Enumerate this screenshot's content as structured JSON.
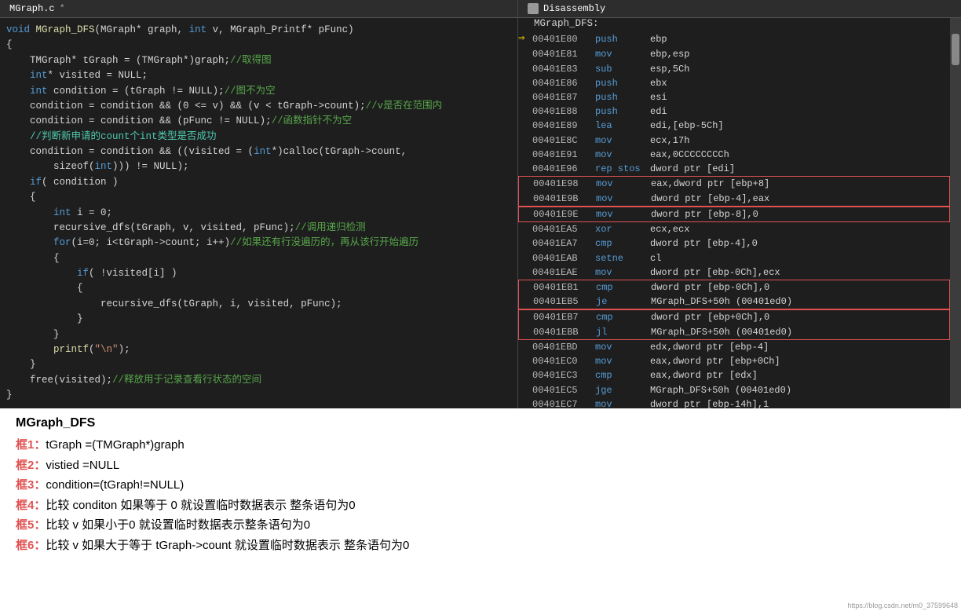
{
  "editor": {
    "tab_label": "MGraph.c",
    "tab_modified": "*",
    "lines": [
      {
        "indent": 0,
        "parts": [
          {
            "t": "kw",
            "v": "void "
          },
          {
            "t": "fn",
            "v": "MGraph_DFS"
          },
          {
            "t": "normal",
            "v": "(MGraph* graph, "
          },
          {
            "t": "kw",
            "v": "int"
          },
          {
            "t": "normal",
            "v": " v, MGraph_Printf* pFunc)"
          }
        ]
      },
      {
        "indent": 0,
        "parts": [
          {
            "t": "normal",
            "v": "{"
          }
        ]
      },
      {
        "indent": 1,
        "parts": [
          {
            "t": "normal",
            "v": "TMGraph* tGraph = (TMGraph*)graph;"
          },
          {
            "t": "cm",
            "v": "//取得图"
          }
        ]
      },
      {
        "indent": 1,
        "parts": [
          {
            "t": "kw",
            "v": "int"
          },
          {
            "t": "normal",
            "v": "* visited = NULL;"
          }
        ]
      },
      {
        "indent": 1,
        "parts": [
          {
            "t": "kw",
            "v": "int"
          },
          {
            "t": "normal",
            "v": " condition = (tGraph != NULL);"
          },
          {
            "t": "cm",
            "v": "//图不为空"
          }
        ]
      },
      {
        "indent": 0,
        "parts": []
      },
      {
        "indent": 1,
        "parts": [
          {
            "t": "normal",
            "v": "condition = condition && (0 <= v) && (v < tGraph->count);"
          },
          {
            "t": "cm",
            "v": "//v是否在范围内"
          }
        ]
      },
      {
        "indent": 1,
        "parts": [
          {
            "t": "normal",
            "v": "condition = condition && (pFunc != NULL);"
          },
          {
            "t": "cm",
            "v": "//函数指针不为空"
          }
        ]
      },
      {
        "indent": 1,
        "parts": [
          {
            "t": "cm-blue",
            "v": "//判断新申请的count个int类型是否成功"
          }
        ]
      },
      {
        "indent": 1,
        "parts": [
          {
            "t": "normal",
            "v": "condition = condition && ((visited = ("
          },
          {
            "t": "kw",
            "v": "int"
          },
          {
            "t": "normal",
            "v": "*)calloc(tGraph->count,"
          }
        ]
      },
      {
        "indent": 2,
        "parts": [
          {
            "t": "normal",
            "v": "sizeof("
          },
          {
            "t": "kw",
            "v": "int"
          },
          {
            "t": "normal",
            "v": "))) != NULL);"
          }
        ]
      },
      {
        "indent": 1,
        "parts": [
          {
            "t": "kw",
            "v": "if"
          },
          {
            "t": "normal",
            "v": "( condition )"
          }
        ]
      },
      {
        "indent": 1,
        "parts": [
          {
            "t": "normal",
            "v": "{"
          }
        ]
      },
      {
        "indent": 2,
        "parts": [
          {
            "t": "kw",
            "v": "int"
          },
          {
            "t": "normal",
            "v": " i = 0;"
          }
        ]
      },
      {
        "indent": 2,
        "parts": [
          {
            "t": "normal",
            "v": "recursive_dfs(tGraph, v, visited, pFunc);"
          },
          {
            "t": "cm",
            "v": "//调用递归检测"
          }
        ]
      },
      {
        "indent": 0,
        "parts": []
      },
      {
        "indent": 2,
        "parts": [
          {
            "t": "kw",
            "v": "for"
          },
          {
            "t": "normal",
            "v": "(i=0; i<tGraph->count; i++)"
          },
          {
            "t": "cm",
            "v": "//如果还有行没遍历的，再从该行开始遍历"
          }
        ]
      },
      {
        "indent": 2,
        "parts": [
          {
            "t": "normal",
            "v": "{"
          }
        ]
      },
      {
        "indent": 3,
        "parts": [
          {
            "t": "kw",
            "v": "if"
          },
          {
            "t": "normal",
            "v": "( !visited[i] )"
          }
        ]
      },
      {
        "indent": 3,
        "parts": [
          {
            "t": "normal",
            "v": "{"
          }
        ]
      },
      {
        "indent": 0,
        "parts": []
      },
      {
        "indent": 4,
        "parts": [
          {
            "t": "normal",
            "v": "recursive_dfs(tGraph, i, visited, pFunc);"
          }
        ]
      },
      {
        "indent": 3,
        "parts": [
          {
            "t": "normal",
            "v": "}"
          }
        ]
      },
      {
        "indent": 2,
        "parts": [
          {
            "t": "normal",
            "v": "}"
          }
        ]
      },
      {
        "indent": 2,
        "parts": [
          {
            "t": "fn",
            "v": "printf"
          },
          {
            "t": "normal",
            "v": "("
          },
          {
            "t": "str",
            "v": "\"\\n\""
          },
          {
            "t": "normal",
            "v": ");"
          }
        ]
      },
      {
        "indent": 1,
        "parts": [
          {
            "t": "normal",
            "v": "}"
          }
        ]
      },
      {
        "indent": 1,
        "parts": [
          {
            "t": "normal",
            "v": "free(visited);"
          },
          {
            "t": "cm",
            "v": "//释放用于记录查看行状态的空间"
          }
        ]
      },
      {
        "indent": 0,
        "parts": [
          {
            "t": "normal",
            "v": "}"
          }
        ]
      },
      {
        "indent": 0,
        "parts": [
          {
            "t": "normal",
            "v": "..."
          }
        ]
      }
    ]
  },
  "disassembly": {
    "tab_label": "Disassembly",
    "function_name": "MGraph_DFS:",
    "rows": [
      {
        "addr": "00401E80",
        "op": "push",
        "operand": "ebp",
        "arrow": true,
        "box_start": false,
        "box_end": false
      },
      {
        "addr": "00401E81",
        "op": "mov",
        "operand": "ebp,esp",
        "arrow": false,
        "box_start": false,
        "box_end": false
      },
      {
        "addr": "00401E83",
        "op": "sub",
        "operand": "esp,5Ch",
        "arrow": false,
        "box_start": false,
        "box_end": false
      },
      {
        "addr": "00401E86",
        "op": "push",
        "operand": "ebx",
        "arrow": false,
        "box_start": false,
        "box_end": false
      },
      {
        "addr": "00401E87",
        "op": "push",
        "operand": "esi",
        "arrow": false,
        "box_start": false,
        "box_end": false
      },
      {
        "addr": "00401E88",
        "op": "push",
        "operand": "edi",
        "arrow": false,
        "box_start": false,
        "box_end": false
      },
      {
        "addr": "00401E89",
        "op": "lea",
        "operand": "edi,[ebp-5Ch]",
        "arrow": false,
        "box_start": false,
        "box_end": false
      },
      {
        "addr": "00401E8C",
        "op": "mov",
        "operand": "ecx,17h",
        "arrow": false,
        "box_start": false,
        "box_end": false
      },
      {
        "addr": "00401E91",
        "op": "mov",
        "operand": "eax,0CCCCCCCCh",
        "arrow": false,
        "box_start": false,
        "box_end": false
      },
      {
        "addr": "00401E96",
        "op": "rep stos",
        "operand": "dword ptr [edi]",
        "arrow": false,
        "box_start": false,
        "box_end": false
      },
      {
        "addr": "00401E98",
        "op": "mov",
        "operand": "eax,dword ptr [ebp+8]",
        "arrow": false,
        "box_start": true,
        "box_end": false,
        "box_group": 1
      },
      {
        "addr": "00401E9B",
        "op": "mov",
        "operand": "dword ptr [ebp-4],eax",
        "arrow": false,
        "box_start": false,
        "box_end": true,
        "box_group": 1
      },
      {
        "addr": "00401E9E",
        "op": "mov",
        "operand": "dword ptr [ebp-8],0",
        "arrow": false,
        "box_start": true,
        "box_end": true,
        "box_group": 2
      },
      {
        "addr": "00401EA5",
        "op": "xor",
        "operand": "ecx,ecx",
        "arrow": false,
        "box_start": false,
        "box_end": false
      },
      {
        "addr": "00401EA7",
        "op": "cmp",
        "operand": "dword ptr [ebp-4],0",
        "arrow": false,
        "box_start": false,
        "box_end": false
      },
      {
        "addr": "00401EAB",
        "op": "setne",
        "operand": "cl",
        "arrow": false,
        "box_start": false,
        "box_end": false
      },
      {
        "addr": "00401EAE",
        "op": "mov",
        "operand": "dword ptr [ebp-0Ch],ecx",
        "arrow": false,
        "box_start": false,
        "box_end": false
      },
      {
        "addr": "00401EB1",
        "op": "cmp",
        "operand": "dword ptr [ebp-0Ch],0",
        "arrow": false,
        "box_start": true,
        "box_end": false,
        "box_group": 3
      },
      {
        "addr": "00401EB5",
        "op": "je",
        "operand": "MGraph_DFS+50h (00401ed0)",
        "arrow": false,
        "box_start": false,
        "box_end": true,
        "box_group": 3
      },
      {
        "addr": "00401EB7",
        "op": "cmp",
        "operand": "dword ptr [ebp+0Ch],0",
        "arrow": false,
        "box_start": true,
        "box_end": false,
        "box_group": 4
      },
      {
        "addr": "00401EBB",
        "op": "jl",
        "operand": "MGraph_DFS+50h (00401ed0)",
        "arrow": false,
        "box_start": false,
        "box_end": true,
        "box_group": 4
      },
      {
        "addr": "00401EBD",
        "op": "mov",
        "operand": "edx,dword ptr [ebp-4]",
        "arrow": false,
        "box_start": false,
        "box_end": false
      },
      {
        "addr": "00401EC0",
        "op": "mov",
        "operand": "eax,dword ptr [ebp+0Ch]",
        "arrow": false,
        "box_start": false,
        "box_end": false
      },
      {
        "addr": "00401EC3",
        "op": "cmp",
        "operand": "eax,dword ptr [edx]",
        "arrow": false,
        "box_start": false,
        "box_end": false
      },
      {
        "addr": "00401EC5",
        "op": "jge",
        "operand": "MGraph_DFS+50h (00401ed0)",
        "arrow": false,
        "box_start": false,
        "box_end": false
      },
      {
        "addr": "00401EC7",
        "op": "mov",
        "operand": "dword ptr [ebp-14h],1",
        "arrow": false,
        "box_start": false,
        "box_end": false
      }
    ]
  },
  "annotations": {
    "title": "MGraph_DFS",
    "items": [
      {
        "label": "框1：",
        "text": "tGraph =(TMGraph*)graph"
      },
      {
        "label": "框2：",
        "text": "vistied =NULL"
      },
      {
        "label": "框3：",
        "text": "condition=(tGraph!=NULL)"
      },
      {
        "label": "框4：",
        "text": "比较 conditon 如果等于 0 就设置临时数据表示 整条语句为0"
      },
      {
        "label": "框5：",
        "text": "比较 v 如果小于0 就设置临时数据表示整条语句为0"
      },
      {
        "label": "框6：",
        "text": "比较 v 如果大于等于 tGraph->count  就设置临时数据表示 整条语句为0"
      }
    ]
  },
  "watermark": "https://blog.csdn.net/m0_37599648"
}
